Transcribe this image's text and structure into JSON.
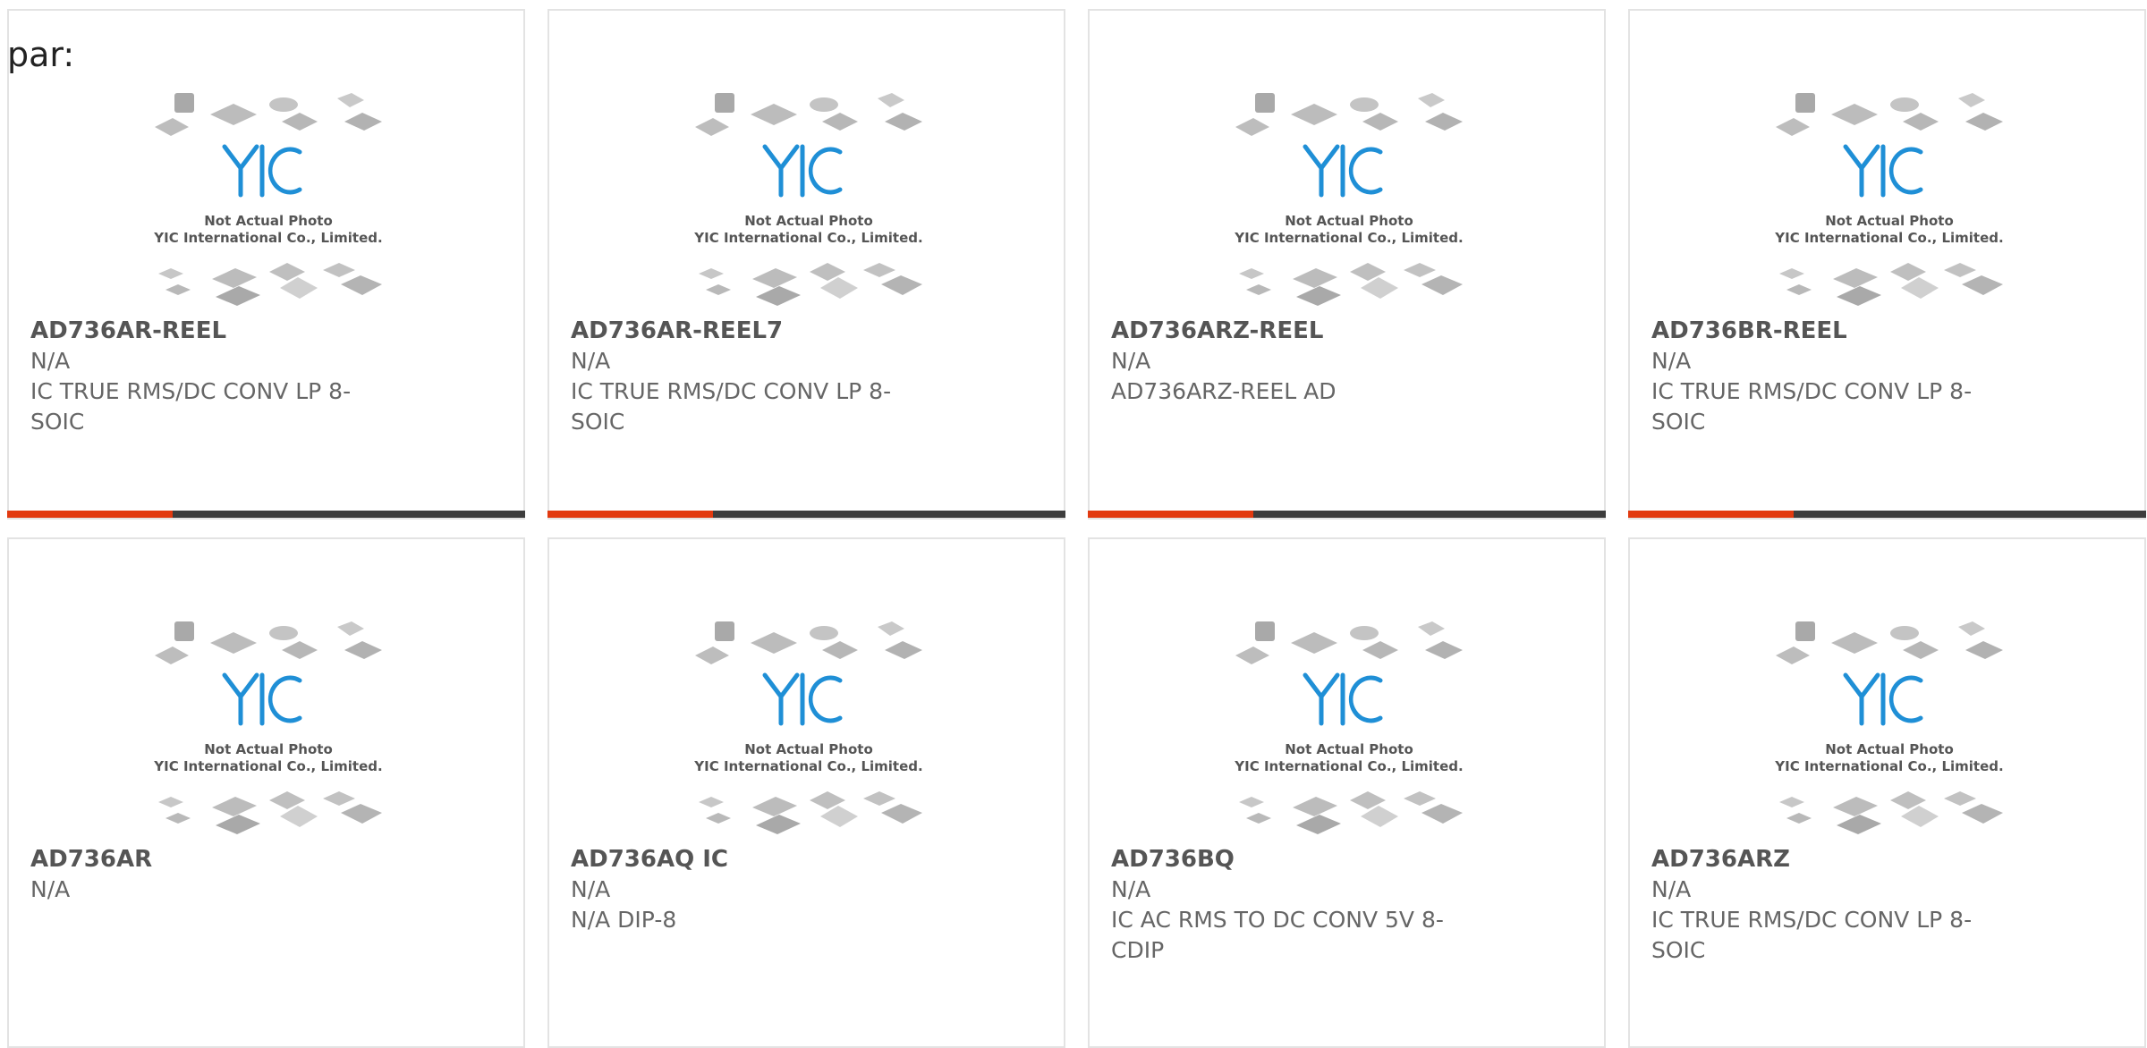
{
  "header": {
    "label": "par:"
  },
  "thumbnail": {
    "brand_text": "YIC",
    "caption_line1": "Not Actual Photo",
    "caption_line2": "YIC International Co., Limited.",
    "brand_color": "#1f8fd6",
    "chip_color": "#b9b9b9"
  },
  "accent_bar": {
    "accent_color": "#e23a10",
    "base_color": "#3d3d3d",
    "accent_fraction": 0.32
  },
  "products": [
    {
      "name": "AD736AR-REEL",
      "manufacturer": "N/A",
      "description": "IC TRUE RMS/DC CONV LP 8-SOIC"
    },
    {
      "name": "AD736AR-REEL7",
      "manufacturer": "N/A",
      "description": "IC TRUE RMS/DC CONV LP 8-SOIC"
    },
    {
      "name": "AD736ARZ-REEL",
      "manufacturer": "N/A",
      "description": "AD736ARZ-REEL AD"
    },
    {
      "name": "AD736BR-REEL",
      "manufacturer": "N/A",
      "description": "IC TRUE RMS/DC CONV LP 8-SOIC"
    },
    {
      "name": "AD736AR",
      "manufacturer": "N/A",
      "description": ""
    },
    {
      "name": "AD736AQ IC",
      "manufacturer": "N/A",
      "description": "N/A DIP-8"
    },
    {
      "name": "AD736BQ",
      "manufacturer": "N/A",
      "description": "IC AC RMS TO DC CONV 5V 8-CDIP"
    },
    {
      "name": "AD736ARZ",
      "manufacturer": "N/A",
      "description": "IC TRUE RMS/DC CONV LP 8-SOIC"
    }
  ]
}
